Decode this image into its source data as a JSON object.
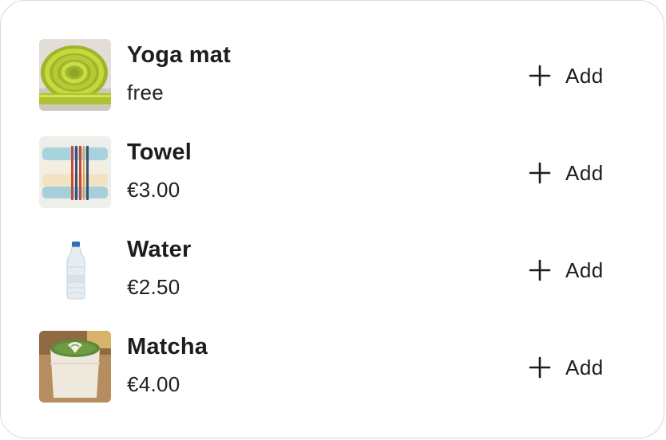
{
  "items": [
    {
      "name": "Yoga mat",
      "price": "free",
      "thumb_icon": "yoga-mat-image",
      "action_label": "Add",
      "action_icon": "plus-icon"
    },
    {
      "name": "Towel",
      "price": "€3.00",
      "thumb_icon": "towel-image",
      "action_label": "Add",
      "action_icon": "plus-icon"
    },
    {
      "name": "Water",
      "price": "€2.50",
      "thumb_icon": "water-bottle-image",
      "action_label": "Add",
      "action_icon": "plus-icon"
    },
    {
      "name": "Matcha",
      "price": "€4.00",
      "thumb_icon": "matcha-image",
      "action_label": "Add",
      "action_icon": "plus-icon"
    }
  ],
  "colors": {
    "border": "#d9d9d9",
    "text": "#1d1d1d",
    "background": "#ffffff"
  }
}
